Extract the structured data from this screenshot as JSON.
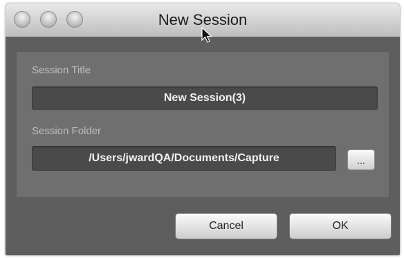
{
  "window": {
    "title": "New Session"
  },
  "form": {
    "session_title_label": "Session Title",
    "session_title_value": "New Session(3)",
    "session_folder_label": "Session Folder",
    "session_folder_value": "/Users/jwardQA/Documents/Capture",
    "browse_label": "..."
  },
  "buttons": {
    "cancel_label": "Cancel",
    "ok_label": "OK"
  },
  "icons": {
    "close": "close-window-icon",
    "minimize": "minimize-window-icon",
    "zoom": "zoom-window-icon",
    "cursor": "mouse-pointer-icon"
  }
}
